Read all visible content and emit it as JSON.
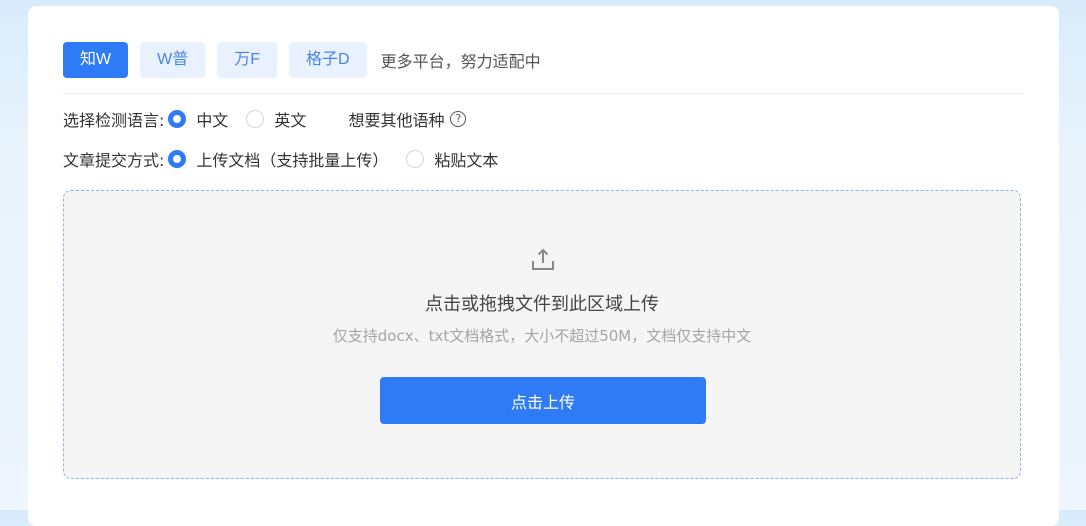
{
  "platforms": [
    {
      "label": "知W",
      "active": true
    },
    {
      "label": "W普",
      "active": false
    },
    {
      "label": "万F",
      "active": false
    },
    {
      "label": "格子D",
      "active": false
    }
  ],
  "more_platforms_text": "更多平台，努力适配中",
  "language": {
    "label": "选择检测语言:",
    "options": [
      "中文",
      "英文"
    ],
    "selected": "中文",
    "other_link": "想要其他语种",
    "help_glyph": "?"
  },
  "submit_method": {
    "label": "文章提交方式:",
    "options": [
      "上传文档（支持批量上传）",
      "粘贴文本"
    ],
    "selected": "上传文档（支持批量上传）"
  },
  "upload": {
    "icon": "upload-icon",
    "title": "点击或拖拽文件到此区域上传",
    "hint": "仅支持docx、txt文档格式，大小不超过50M，文档仅支持中文",
    "button_label": "点击上传"
  },
  "colors": {
    "accent": "#2f7af5",
    "accent_light": "#e8f1fd"
  }
}
